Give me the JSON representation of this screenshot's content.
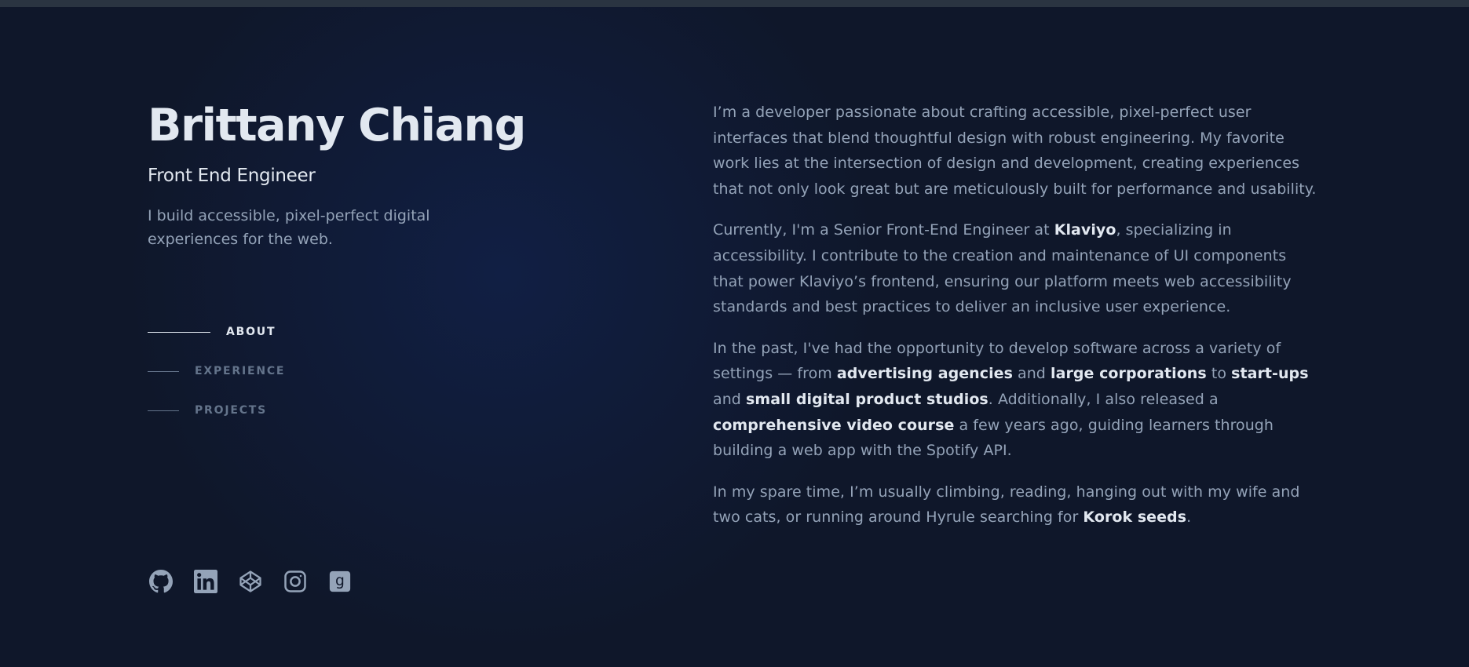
{
  "header": {
    "name": "Brittany Chiang",
    "role": "Front End Engineer",
    "tagline": "I build accessible, pixel-perfect digital experiences for the web."
  },
  "nav": {
    "items": [
      {
        "label": "ABOUT",
        "active": true
      },
      {
        "label": "EXPERIENCE",
        "active": false
      },
      {
        "label": "PROJECTS",
        "active": false
      }
    ]
  },
  "socials": [
    {
      "icon": "github-icon"
    },
    {
      "icon": "linkedin-icon"
    },
    {
      "icon": "codepen-icon"
    },
    {
      "icon": "instagram-icon"
    },
    {
      "icon": "goodreads-icon"
    }
  ],
  "about": {
    "p1": "I’m a developer passionate about crafting accessible, pixel-perfect user interfaces that blend thoughtful design with robust engineering. My favorite work lies at the intersection of design and development, creating experiences that not only look great but are meticulously built for performance and usability.",
    "p2": {
      "t1": "Currently, I'm a Senior Front-End Engineer at ",
      "link_klaviyo": "Klaviyo",
      "t2": ", specializing in accessibility. I contribute to the creation and maintenance of UI components that power Klaviyo’s frontend, ensuring our platform meets web accessibility standards and best practices to deliver an inclusive user experience."
    },
    "p3": {
      "t1": "In the past, I've had the opportunity to develop software across a variety of settings — from ",
      "link_agencies": "advertising agencies",
      "t2": " and ",
      "link_corporations": "large corporations",
      "t3": " to ",
      "link_startups": "start-ups",
      "t4": " and ",
      "link_studios": "small digital product studios",
      "t5": ". Additionally, I also released a ",
      "link_course": "comprehensive video course",
      "t6": " a few years ago, guiding learners through building a web app with the Spotify API."
    },
    "p4": {
      "t1": "In my spare time, I’m usually climbing, reading, hanging out with my wife and two cats, or running around Hyrule searching for ",
      "link_korok": "Korok seeds",
      "t2": "."
    }
  },
  "colors": {
    "background": "#0f172a",
    "heading": "#e2e8f0",
    "body_text": "#94a3b8",
    "muted": "#64748b"
  }
}
